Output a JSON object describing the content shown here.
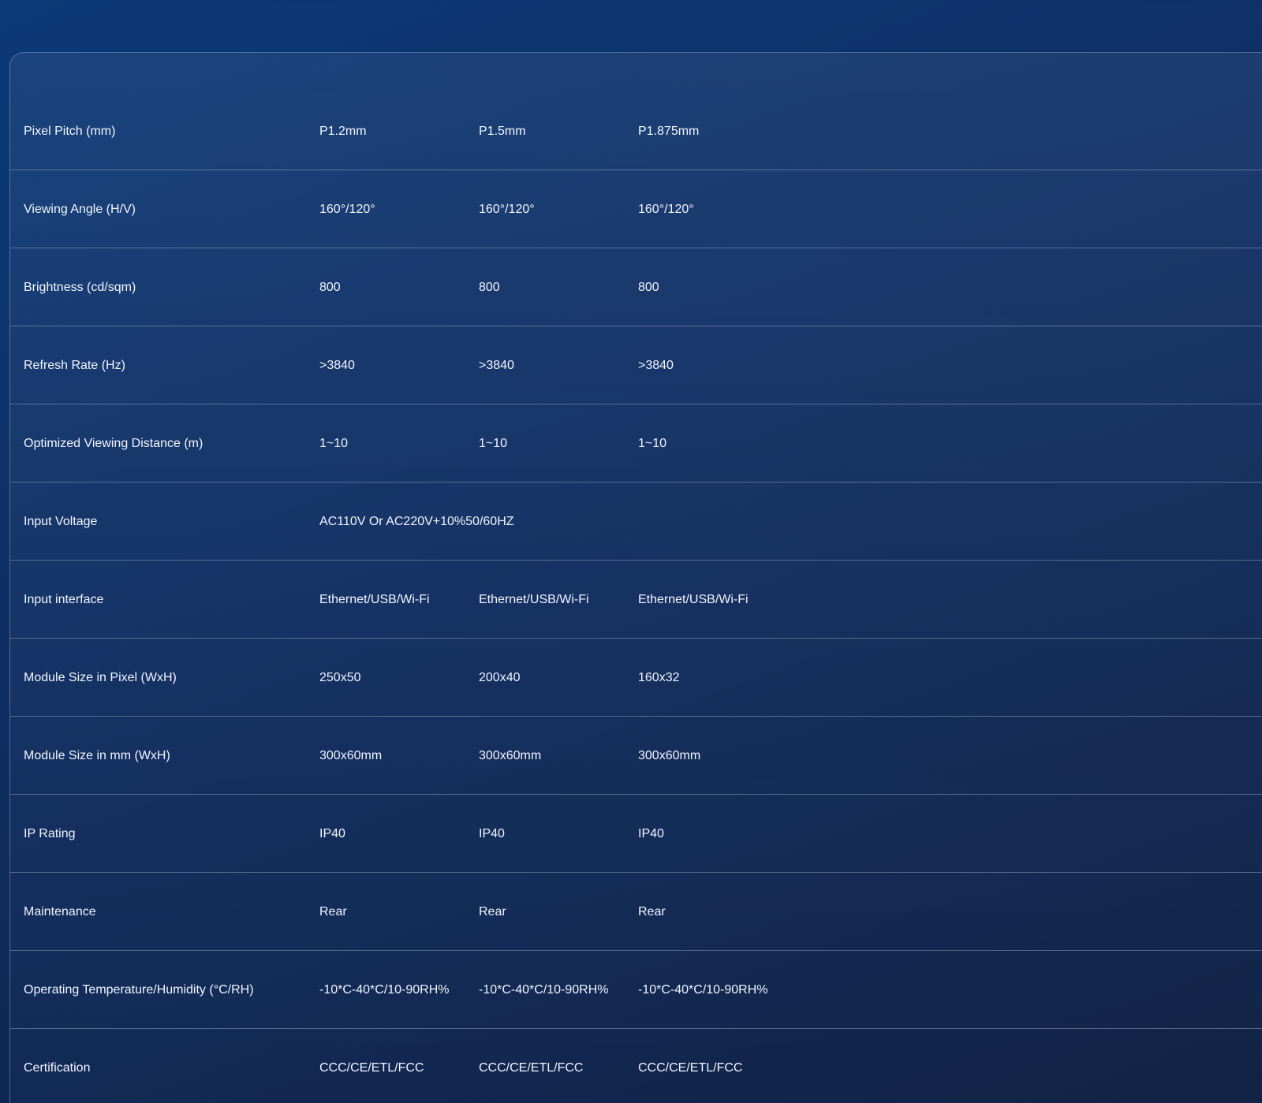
{
  "spec_table": {
    "rows": [
      {
        "label": "Pixel Pitch (mm)",
        "values": [
          "P1.2mm",
          "P1.5mm",
          "P1.875mm"
        ]
      },
      {
        "label": "Viewing Angle (H/V)",
        "values": [
          "160°/120°",
          "160°/120°",
          "160°/120°"
        ]
      },
      {
        "label": "Brightness (cd/sqm)",
        "values": [
          "800",
          "800",
          "800"
        ]
      },
      {
        "label": "Refresh Rate (Hz)",
        "values": [
          ">3840",
          ">3840",
          ">3840"
        ]
      },
      {
        "label": "Optimized Viewing Distance (m)",
        "values": [
          "1~10",
          "1~10",
          "1~10"
        ]
      },
      {
        "label": "Input Voltage",
        "values": [
          "AC110V Or AC220V+10%50/60HZ",
          "",
          ""
        ]
      },
      {
        "label": "Input interface",
        "values": [
          "Ethernet/USB/Wi-Fi",
          "Ethernet/USB/Wi-Fi",
          "Ethernet/USB/Wi-Fi"
        ]
      },
      {
        "label": "Module Size in Pixel (WxH)",
        "values": [
          "250x50",
          "200x40",
          "160x32"
        ]
      },
      {
        "label": "Module Size in mm (WxH)",
        "values": [
          "300x60mm",
          "300x60mm",
          "300x60mm"
        ]
      },
      {
        "label": "IP Rating",
        "values": [
          "IP40",
          "IP40",
          "IP40"
        ]
      },
      {
        "label": "Maintenance",
        "values": [
          "Rear",
          "Rear",
          "Rear"
        ]
      },
      {
        "label": "Operating Temperature/Humidity (°C/RH)",
        "values": [
          "-10*C-40*C/10-90RH%",
          "-10*C-40*C/10-90RH%",
          "-10*C-40*C/10-90RH%"
        ]
      },
      {
        "label": "Certification",
        "values": [
          "CCC/CE/ETL/FCC",
          "CCC/CE/ETL/FCC",
          "CCC/CE/ETL/FCC"
        ]
      }
    ]
  }
}
